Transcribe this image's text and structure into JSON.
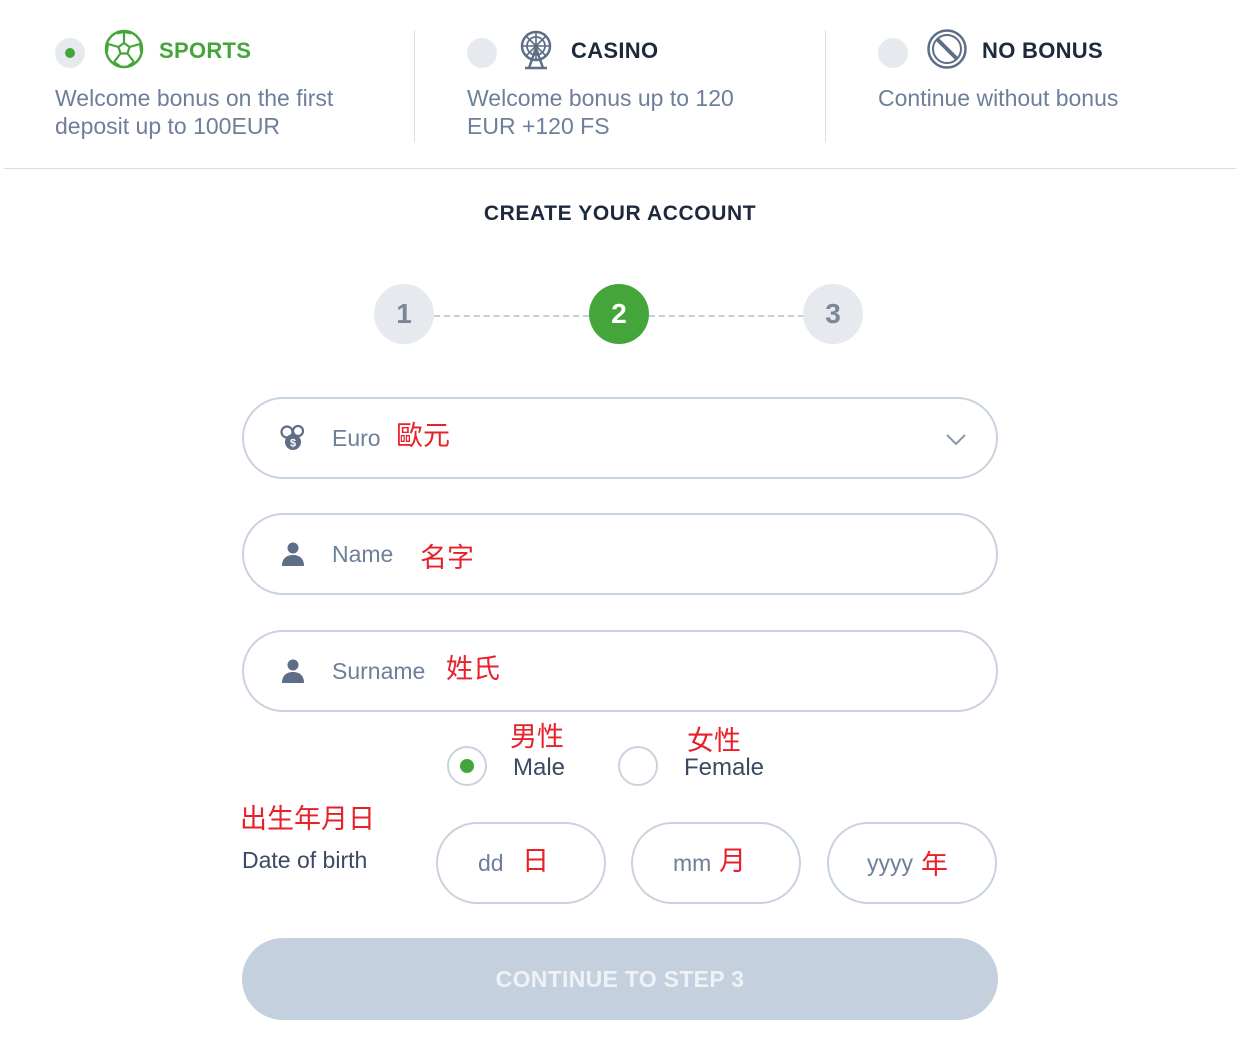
{
  "bonus": {
    "options": [
      {
        "title": "SPORTS",
        "desc_line1": "Welcome bonus on the first",
        "desc_line2": "deposit up to 100EUR",
        "icon": "soccer-ball-icon",
        "selected": true
      },
      {
        "title": "CASINO",
        "desc_line1": "Welcome bonus up to 120",
        "desc_line2": "EUR +120 FS",
        "icon": "ferris-wheel-icon",
        "selected": false
      },
      {
        "title": "NO BONUS",
        "desc_line1": "Continue without bonus",
        "desc_line2": "",
        "icon": "prohibited-icon",
        "selected": false
      }
    ]
  },
  "header": {
    "title": "CREATE YOUR ACCOUNT"
  },
  "steps": {
    "items": [
      "1",
      "2",
      "3"
    ],
    "active": "2"
  },
  "form": {
    "currency": {
      "value": "Euro",
      "note": "歐元",
      "icon": "coins-icon"
    },
    "name": {
      "placeholder": "Name",
      "note": "名字",
      "icon": "user-icon"
    },
    "surname": {
      "placeholder": "Surname",
      "note": "姓氏",
      "icon": "user-icon"
    },
    "gender": {
      "male_label": "Male",
      "male_note": "男性",
      "male_selected": true,
      "female_label": "Female",
      "female_note": "女性"
    },
    "dob": {
      "label": "Date of birth",
      "note": "出生年月日",
      "dd": "dd",
      "dd_note": "日",
      "mm": "mm",
      "mm_note": "月",
      "yyyy": "yyyy",
      "yyyy_note": "年"
    },
    "submit_label": "CONTINUE TO STEP 3"
  },
  "colors": {
    "accent": "#44a63a",
    "annotation": "#e8202a",
    "muted": "#6d7f9a",
    "disabled_button": "#c5d0de"
  }
}
